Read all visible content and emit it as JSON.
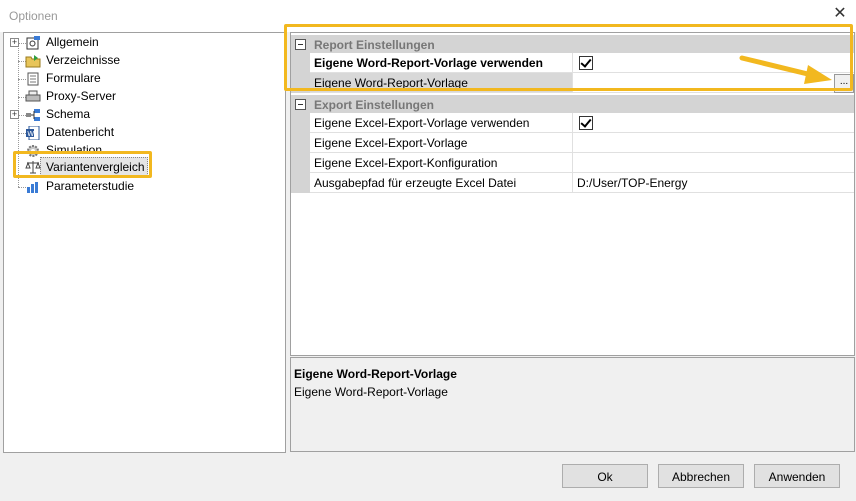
{
  "window": {
    "title": "Optionen"
  },
  "tree": {
    "items": [
      {
        "label": "Allgemein",
        "icon": "settings-doc-icon",
        "expandable": true
      },
      {
        "label": "Verzeichnisse",
        "icon": "folder-icon",
        "expandable": false
      },
      {
        "label": "Formulare",
        "icon": "form-icon",
        "expandable": false
      },
      {
        "label": "Proxy-Server",
        "icon": "printer-icon",
        "expandable": false
      },
      {
        "label": "Schema",
        "icon": "schema-icon",
        "expandable": true
      },
      {
        "label": "Datenbericht",
        "icon": "word-icon",
        "expandable": false
      },
      {
        "label": "Simulation",
        "icon": "gear-icon",
        "expandable": false
      },
      {
        "label": "Variantenvergleich",
        "icon": "scale-icon",
        "expandable": false,
        "selected": true
      },
      {
        "label": "Parameterstudie",
        "icon": "chart-icon",
        "expandable": false
      }
    ]
  },
  "grid": {
    "report_category": "Report Einstellungen",
    "report_rows": [
      {
        "name": "Eigene Word-Report-Vorlage verwenden",
        "checked": true
      },
      {
        "name": "Eigene Word-Report-Vorlage",
        "value": "",
        "button": "..."
      }
    ],
    "export_category": "Export Einstellungen",
    "export_rows": [
      {
        "name": "Eigene Excel-Export-Vorlage verwenden",
        "checked": true
      },
      {
        "name": "Eigene Excel-Export-Vorlage",
        "value": ""
      },
      {
        "name": "Eigene Excel-Export-Konfiguration",
        "value": ""
      },
      {
        "name": "Ausgabepfad für erzeugte Excel Datei",
        "value": "D:/User/TOP-Energy"
      }
    ]
  },
  "description": {
    "title": "Eigene Word-Report-Vorlage",
    "text": "Eigene Word-Report-Vorlage"
  },
  "buttons": {
    "ok": "Ok",
    "cancel": "Abbrechen",
    "apply": "Anwenden"
  },
  "colors": {
    "highlight": "#f2b81f",
    "arrow": "#f2b81f"
  }
}
